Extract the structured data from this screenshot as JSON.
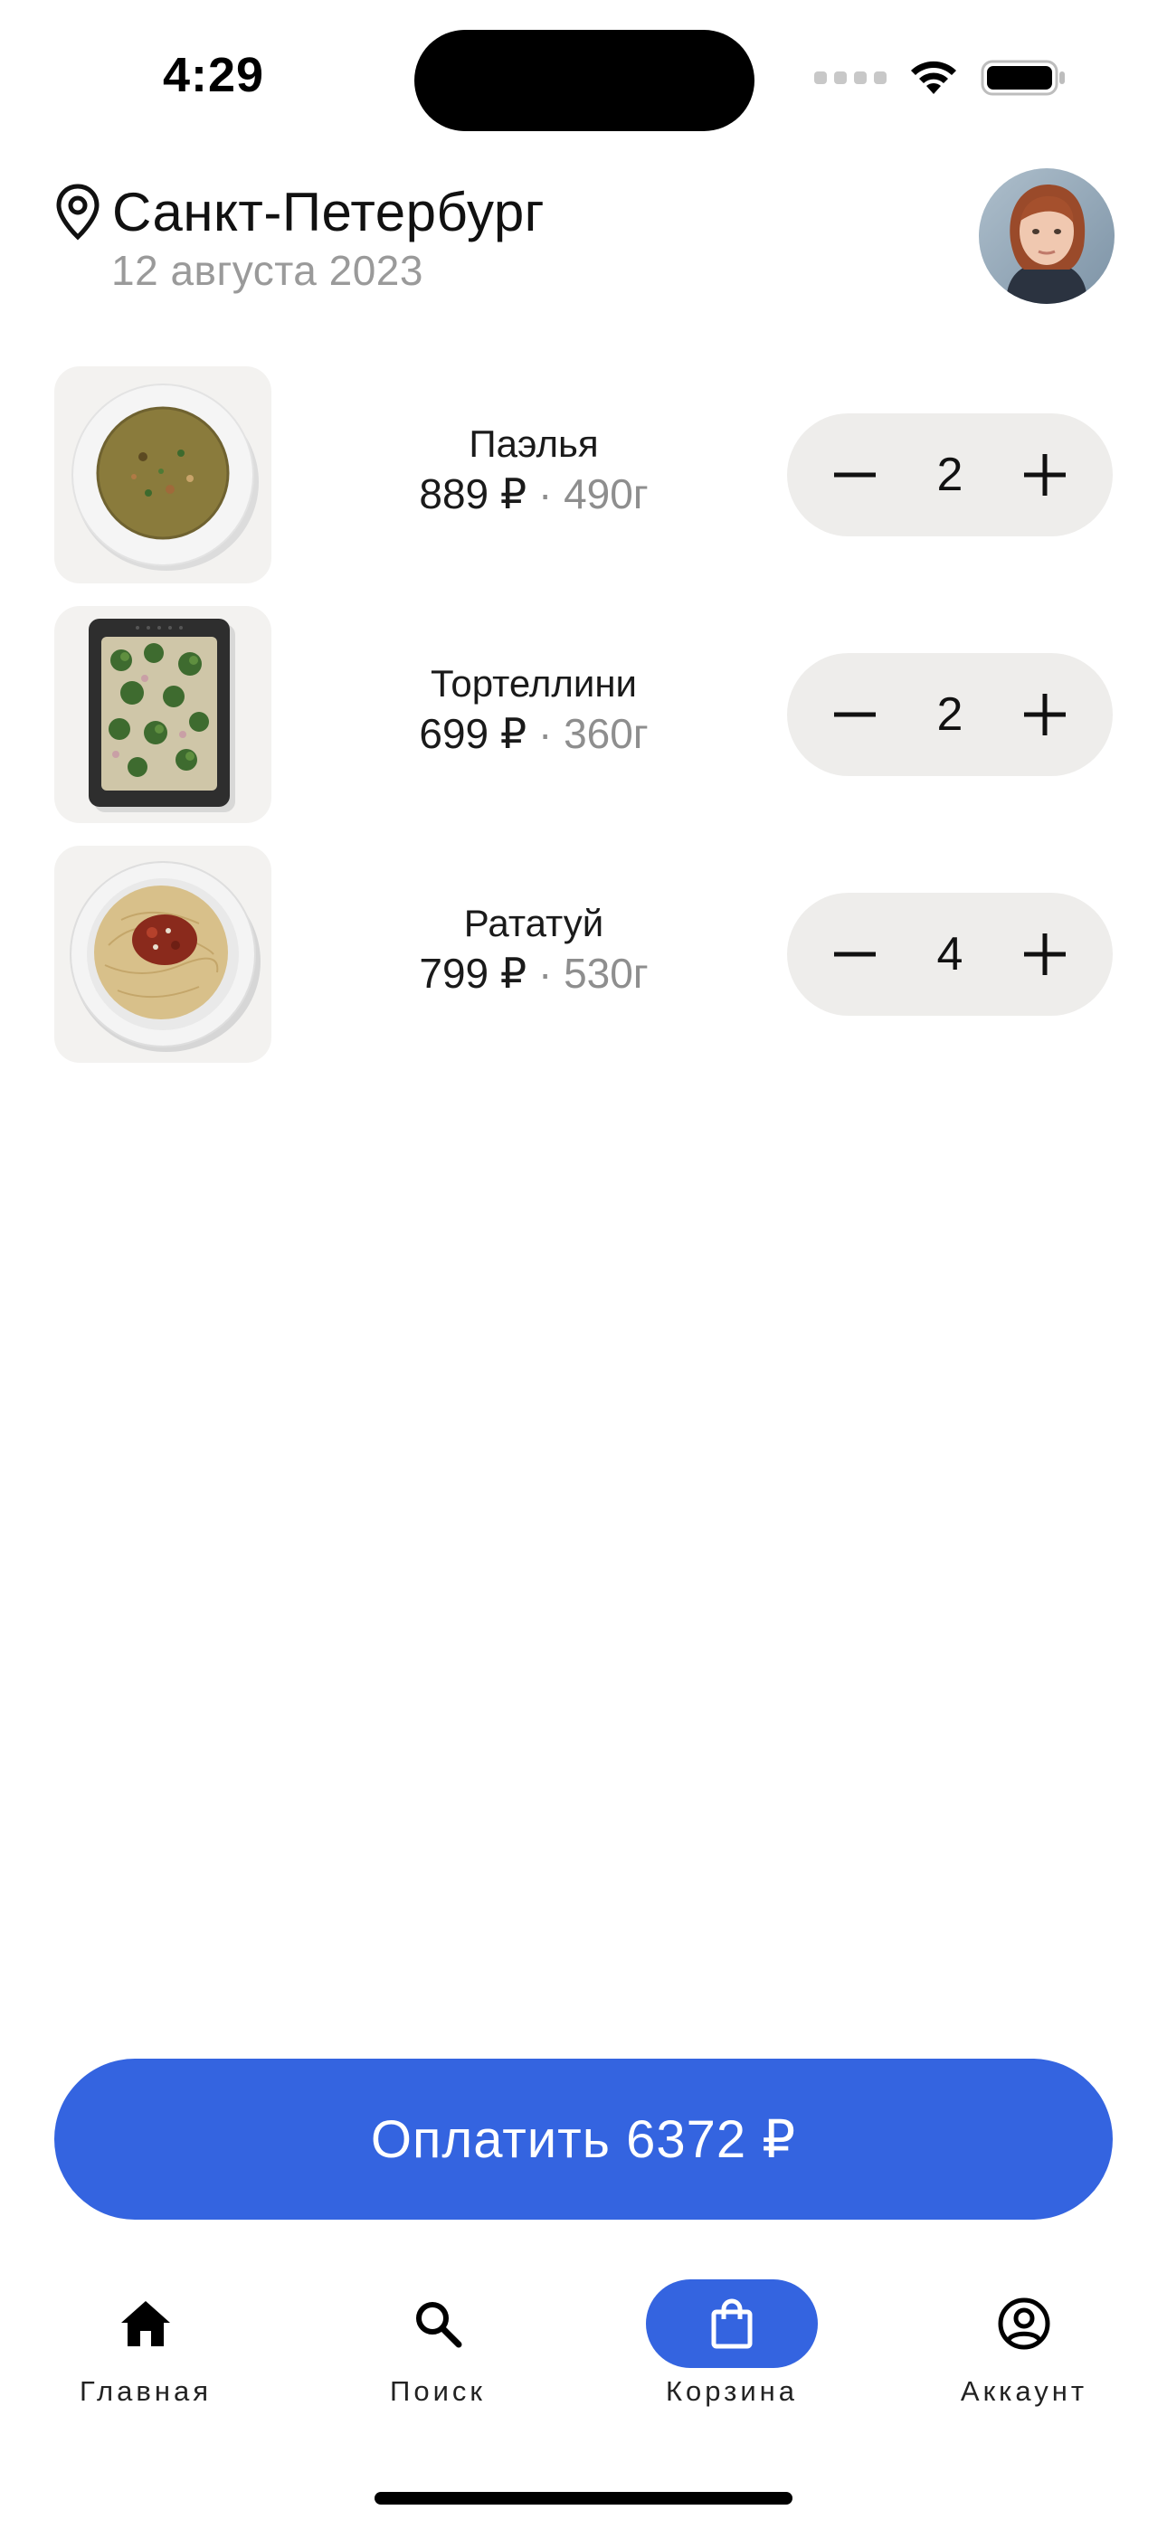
{
  "status_bar": {
    "time": "4:29"
  },
  "header": {
    "city": "Санкт-Петербург",
    "date": "12 августа 2023",
    "icons": {
      "location": "location-pin-icon",
      "avatar": "user-avatar"
    }
  },
  "cart": {
    "items": [
      {
        "name": "Паэлья",
        "price": "889 ₽",
        "separator": "·",
        "weight": "490г",
        "quantity": "2",
        "image": "soup-bowl"
      },
      {
        "name": "Тортеллини",
        "price": "699 ₽",
        "separator": "·",
        "weight": "360г",
        "quantity": "2",
        "image": "baking-tray-broccoli"
      },
      {
        "name": "Рататуй",
        "price": "799 ₽",
        "separator": "·",
        "weight": "530г",
        "quantity": "4",
        "image": "spaghetti-plate"
      }
    ]
  },
  "pay_button": {
    "label": "Оплатить 6372 ₽"
  },
  "tabbar": {
    "tabs": [
      {
        "label": "Главная",
        "icon": "home-icon",
        "active": false
      },
      {
        "label": "Поиск",
        "icon": "search-icon",
        "active": false
      },
      {
        "label": "Корзина",
        "icon": "shopping-bag-icon",
        "active": true
      },
      {
        "label": "Аккаунт",
        "icon": "account-icon",
        "active": false
      }
    ]
  },
  "colors": {
    "accent": "#3464e0",
    "stepper_bg": "#eeedeb",
    "muted_text": "#9a9a9a"
  }
}
